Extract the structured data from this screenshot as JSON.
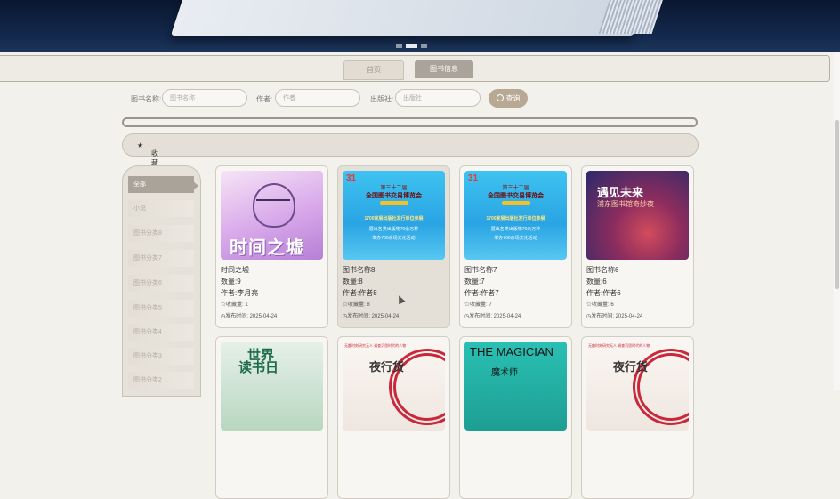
{
  "banner": {
    "slides": 3,
    "active_slide": 2
  },
  "nav": {
    "home": "首页",
    "books": "图书信息"
  },
  "search": {
    "name_label": "图书名称:",
    "name_placeholder": "图书名称",
    "author_label": "作者:",
    "author_placeholder": "作者",
    "publisher_label": "出版社:",
    "publisher_placeholder": "出版社",
    "button": "查询"
  },
  "fav_sort": "收藏数",
  "categories": [
    "全部",
    "小说",
    "图书分类8",
    "图书分类7",
    "图书分类6",
    "图书分类5",
    "图书分类4",
    "图书分类3",
    "图书分类2"
  ],
  "cards": [
    {
      "title": "时间之墟",
      "qty": "数量:9",
      "author": "作者:李月亮",
      "fav": "☆收藏量: 1",
      "date": "◷发布时间: 2025-04-24",
      "cover": {
        "big": "时间之墟"
      }
    },
    {
      "title": "图书名称8",
      "qty": "数量:8",
      "author": "作者:作者8",
      "fav": "☆收藏量: 8",
      "date": "◷发布时间: 2025-04-24",
      "cover": {
        "logo": "31",
        "t1": "第三十二届",
        "t2": "全国图书交易博览会",
        "r1": "1700家展出版社发行单位参展",
        "r2": "展出各类出版物70余万种",
        "r3": "举办700余场文化活动"
      }
    },
    {
      "title": "图书名称7",
      "qty": "数量:7",
      "author": "作者:作者7",
      "fav": "☆收藏量: 7",
      "date": "◷发布时间: 2025-04-24",
      "cover": {
        "logo": "31",
        "t1": "第三十二届",
        "t2": "全国图书交易博览会",
        "r1": "1700家展出版社发行单位参展",
        "r2": "展出各类出版物70余万种",
        "r3": "举办700余场文化活动"
      }
    },
    {
      "title": "图书名称6",
      "qty": "数量:6",
      "author": "作者:作者6",
      "fav": "☆收藏量: 6",
      "date": "◷发布时间: 2025-04-24",
      "cover": {
        "t1": "遇见未来",
        "t2": "浦东图书馆奇妙夜"
      }
    },
    {
      "cover": {
        "t1": "世界",
        "t2": "读书日"
      }
    },
    {
      "cover": {
        "t1": "夜行货",
        "top": "无趣时刻研究无人 调查沉思时代的人物"
      }
    },
    {
      "cover": {
        "t1": "THE MAGICIAN",
        "t2": "魔术师"
      }
    },
    {
      "cover": {
        "t1": "夜行货",
        "top": "无趣时刻研究无人 调查沉思时代的人物"
      }
    }
  ]
}
